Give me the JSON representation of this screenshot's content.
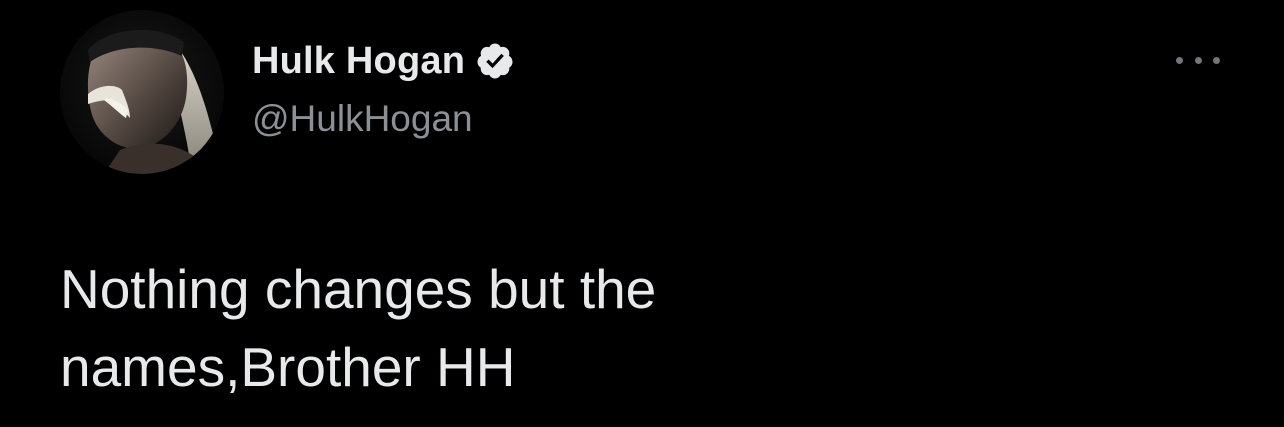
{
  "tweet": {
    "author": {
      "display_name": "Hulk Hogan",
      "handle": "@HulkHogan",
      "verified": true,
      "avatar_icon": "profile-photo",
      "verified_color": "#e7e9ea"
    },
    "more_menu_icon": "ellipsis-icon",
    "text_lines": [
      "Nothing changes but the",
      "names,Brother HH"
    ]
  },
  "theme": {
    "background": "#000000",
    "primary_text": "#e7e9ea",
    "secondary_text": "#8b9096"
  }
}
